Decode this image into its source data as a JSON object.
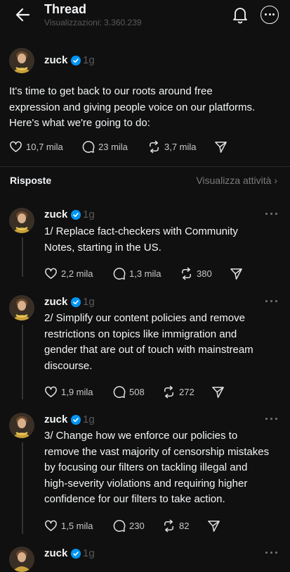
{
  "header": {
    "title": "Thread",
    "views": "Visualizzazioni: 3.360.239",
    "icons": [
      "back-arrow-icon",
      "bell-icon",
      "more-icon"
    ]
  },
  "main_post": {
    "author": "zuck",
    "time": "1g",
    "lines": [
      "It's time to get back to our roots around free",
      "expression and giving people voice on our platforms.",
      "Here's what we're going to do:"
    ],
    "likes": "10,7 mila",
    "comments": "23 mila",
    "reposts": "3,7 mila"
  },
  "replies_bar": {
    "label": "Risposte",
    "activity": "Visualizza attività ›"
  },
  "replies": [
    {
      "author": "zuck",
      "time": "1g",
      "lines": [
        "1/ Replace fact-checkers with Community",
        "Notes, starting in the US."
      ],
      "likes": "2,2 mila",
      "comments": "1,3 mila",
      "reposts": "380"
    },
    {
      "author": "zuck",
      "time": "1g",
      "lines": [
        "2/ Simplify our content policies and remove",
        "restrictions on topics like immigration and",
        "gender that are out of touch with mainstream",
        "discourse."
      ],
      "likes": "1,9 mila",
      "comments": "508",
      "reposts": "272"
    },
    {
      "author": "zuck",
      "time": "1g",
      "lines": [
        "3/ Change how we enforce our policies to",
        "remove the vast majority of censorship mistakes",
        "by focusing our filters on tackling illegal and",
        "high-severity violations and requiring higher",
        "confidence for our filters to take action."
      ],
      "likes": "1,5 mila",
      "comments": "230",
      "reposts": "82"
    },
    {
      "author": "zuck",
      "time": "1g"
    }
  ],
  "colors": {
    "background": "#101010",
    "text": "#f3f5f7",
    "muted": "#5a5a5a",
    "verified": "#0095f6"
  }
}
